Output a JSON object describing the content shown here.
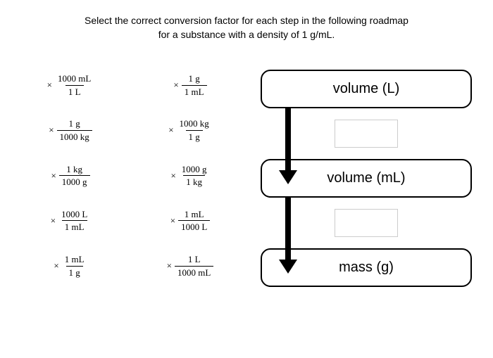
{
  "instruction": {
    "line1": "Select the correct conversion factor for each step in the following roadmap",
    "line2": "for a substance with a density of 1 g/mL."
  },
  "options": [
    {
      "a": {
        "num": "1000 mL",
        "den": "1 L"
      },
      "b": {
        "num": "1 g",
        "den": "1 mL"
      }
    },
    {
      "a": {
        "num": "1 g",
        "den": "1000 kg"
      },
      "b": {
        "num": "1000 kg",
        "den": "1 g"
      }
    },
    {
      "a": {
        "num": "1 kg",
        "den": "1000 g"
      },
      "b": {
        "num": "1000 g",
        "den": "1 kg"
      }
    },
    {
      "a": {
        "num": "1000 L",
        "den": "1 mL"
      },
      "b": {
        "num": "1 mL",
        "den": "1000 L"
      }
    },
    {
      "a": {
        "num": "1 mL",
        "den": "1 g"
      },
      "b": {
        "num": "1 L",
        "den": "1000 mL"
      }
    }
  ],
  "stages": {
    "s1": "volume (L)",
    "s2": "volume (mL)",
    "s3": "mass (g)"
  }
}
